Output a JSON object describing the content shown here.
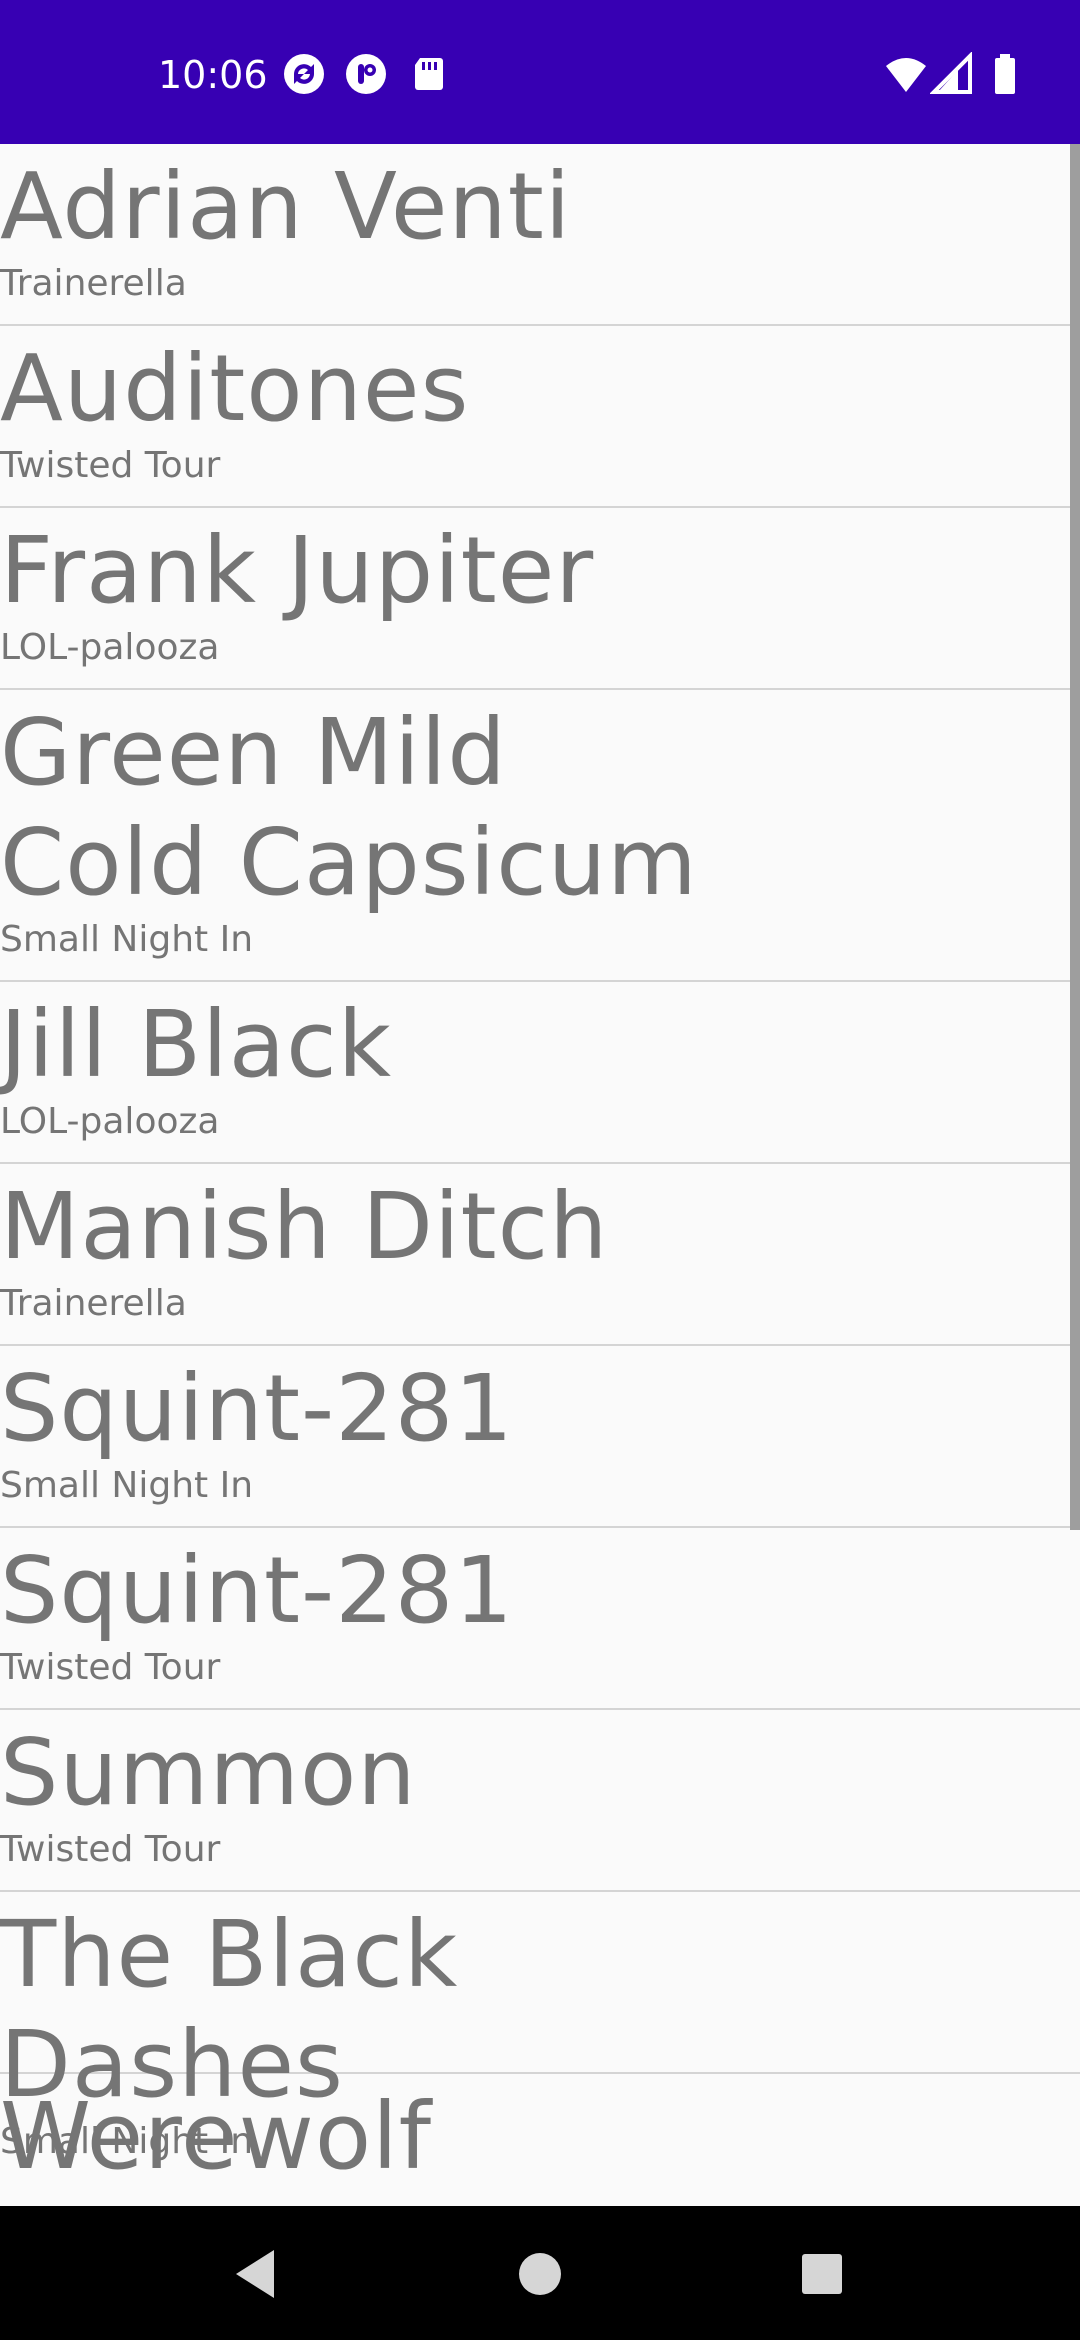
{
  "status_bar": {
    "time": "10:06",
    "background_color": "#3700b3",
    "left_icons": [
      "sync-icon",
      "app-notification-icon",
      "sd-card-icon"
    ],
    "right_icons": [
      "wifi-icon",
      "signal-icon",
      "battery-icon"
    ]
  },
  "list": {
    "items": [
      {
        "title": "Adrian Venti",
        "subtitle": "Trainerella"
      },
      {
        "title": "Auditones",
        "subtitle": "Twisted Tour"
      },
      {
        "title": "Frank Jupiter",
        "subtitle": "LOL-palooza"
      },
      {
        "title": "Green Mild Cold Capsicum",
        "subtitle": "Small Night In"
      },
      {
        "title": "Jill Black",
        "subtitle": "LOL-palooza"
      },
      {
        "title": "Manish Ditch",
        "subtitle": "Trainerella"
      },
      {
        "title": "Squint-281",
        "subtitle": "Small Night In"
      },
      {
        "title": "Squint-281",
        "subtitle": "Twisted Tour"
      },
      {
        "title": "Summon",
        "subtitle": "Twisted Tour"
      },
      {
        "title": "The Black Dashes",
        "subtitle": "Small Night In"
      },
      {
        "title": "Werewolf Weekday",
        "subtitle": ""
      }
    ]
  },
  "nav_bar": {
    "buttons": [
      "back-icon",
      "home-icon",
      "recents-icon"
    ]
  }
}
